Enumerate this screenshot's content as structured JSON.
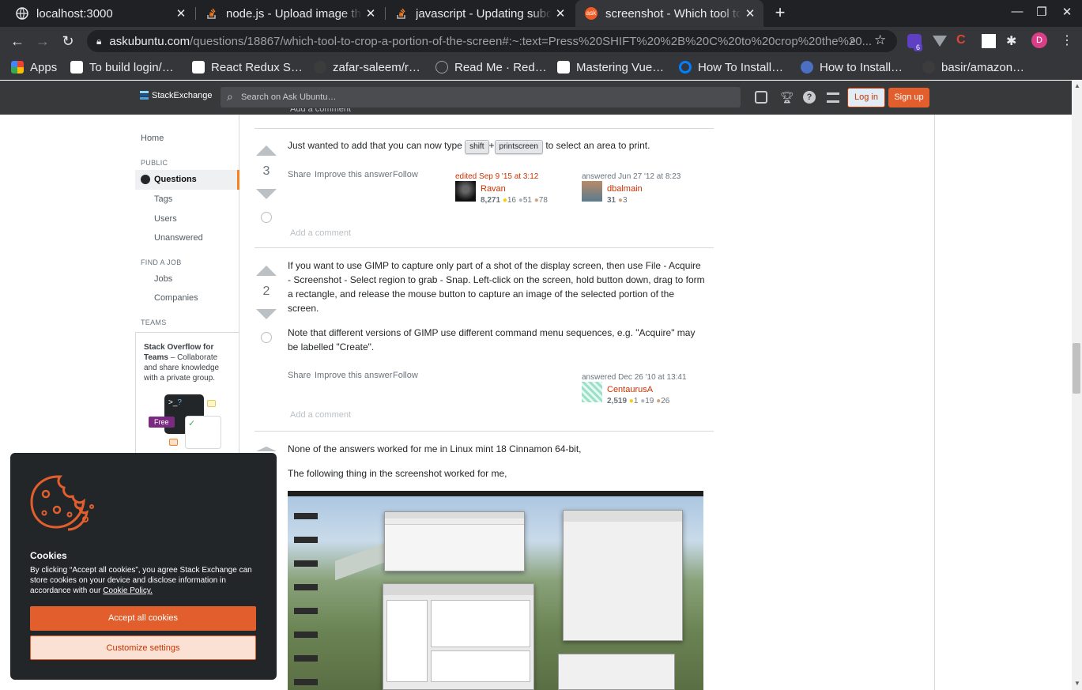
{
  "browser": {
    "tabs": [
      {
        "title": "localhost:3000",
        "active": false
      },
      {
        "title": "node.js - Upload image thr",
        "active": false
      },
      {
        "title": "javascript - Updating subd",
        "active": false
      },
      {
        "title": "screenshot - Which tool to",
        "active": true
      }
    ],
    "url_host": "askubuntu.com",
    "url_path": "/questions/18867/which-tool-to-crop-a-portion-of-the-screen#:~:text=Press%20SHIFT%20%2B%20C%20to%20crop%20the%20...",
    "extension_badge": "6",
    "profile_initial": "D",
    "bookmarks": [
      "Apps",
      "To build login/…",
      "React Redux S…",
      "zafar-saleem/r…",
      "Read Me · Red…",
      "Mastering Vue…",
      "How To Install…",
      "How to Install…",
      "basir/amazon…"
    ]
  },
  "topbar": {
    "logo_text": "StackExchange",
    "search_placeholder": "Search on Ask Ubuntu…",
    "login_label": "Log in",
    "signup_label": "Sign up"
  },
  "leftnav": {
    "home": "Home",
    "public_heading": "PUBLIC",
    "questions": "Questions",
    "tags": "Tags",
    "users": "Users",
    "unanswered": "Unanswered",
    "find_job_heading": "FIND A JOB",
    "jobs": "Jobs",
    "companies": "Companies",
    "teams_heading": "TEAMS",
    "teams_title": "Stack Overflow for Teams",
    "teams_text": " – Collaborate and share knowledge with a private group.",
    "free_badge": "Free"
  },
  "prev_add_comment": "Add a comment",
  "answers": [
    {
      "score": "3",
      "text_before": "Just wanted to add that you can now type",
      "key1": "shift",
      "plus": "+",
      "key2": "printscreen",
      "text_after": "to select an area to print.",
      "share": "Share",
      "improve": "Improve this answer",
      "follow": "Follow",
      "edited": "edited Sep 9 '15 at 3:12",
      "editor": {
        "name": "Ravan",
        "rep": "8,271",
        "gold": "16",
        "silver": "51",
        "bronze": "78"
      },
      "answered": "answered Jun 27 '12 at 8:23",
      "author": {
        "name": "dbalmain",
        "rep": "31",
        "bronze": "3"
      },
      "add_comment": "Add a comment"
    },
    {
      "score": "2",
      "para1": "If you want to use GIMP to capture only part of a shot of the display screen, then use File - Acquire - Screenshot - Select region to grab - Snap. Left-click on the screen, hold button down, drag to form a rectangle, and release the mouse button to capture an image of the selected portion of the screen.",
      "para2": "Note that different versions of GIMP use different command menu sequences, e.g. \"Acquire\" may be labelled \"Create\".",
      "share": "Share",
      "improve": "Improve this answer",
      "follow": "Follow",
      "answered": "answered Dec 26 '10 at 13:41",
      "author": {
        "name": "CentaurusA",
        "rep": "2,519",
        "gold": "1",
        "silver": "19",
        "bronze": "26"
      },
      "add_comment": "Add a comment"
    },
    {
      "para1": "None of the answers worked for me in Linux mint 18 Cinnamon 64-bit,",
      "para2": "The following thing in the screenshot worked for me,"
    }
  ],
  "cookie": {
    "title": "Cookies",
    "body": "By clicking “Accept all cookies”, you agree Stack Exchange can store cookies on your device and disclose information in accordance with our ",
    "policy_link": "Cookie Policy.",
    "accept": "Accept all cookies",
    "customize": "Customize settings"
  },
  "colors": {
    "accent": "#f48225",
    "link": "#cc3300",
    "button": "#e25f2d",
    "topbar": "#37393b",
    "chrome_dark": "#202124"
  }
}
